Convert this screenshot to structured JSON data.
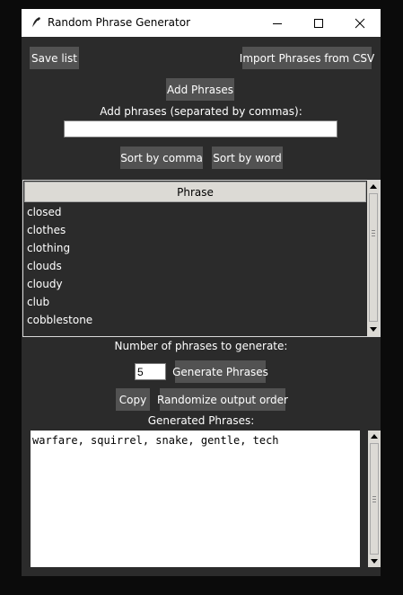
{
  "window": {
    "title": "Random Phrase Generator"
  },
  "toolbar": {
    "save_list": "Save list",
    "import_csv": "Import Phrases from CSV",
    "add_phrases": "Add Phrases"
  },
  "add_input": {
    "label": "Add phrases (separated by commas):",
    "value": ""
  },
  "sort": {
    "by_comma": "Sort by comma",
    "by_word": "Sort by word"
  },
  "phrase_table": {
    "header": "Phrase",
    "rows": [
      "closed",
      "clothes",
      "clothing",
      "clouds",
      "cloudy",
      "club",
      "cobblestone"
    ]
  },
  "generate": {
    "count_label": "Number of phrases to generate:",
    "count_value": "5",
    "button": "Generate Phrases"
  },
  "actions": {
    "copy": "Copy",
    "randomize": "Randomize output order"
  },
  "output": {
    "label": "Generated Phrases:",
    "text": "warfare, squirrel, snake, gentle, tech"
  }
}
